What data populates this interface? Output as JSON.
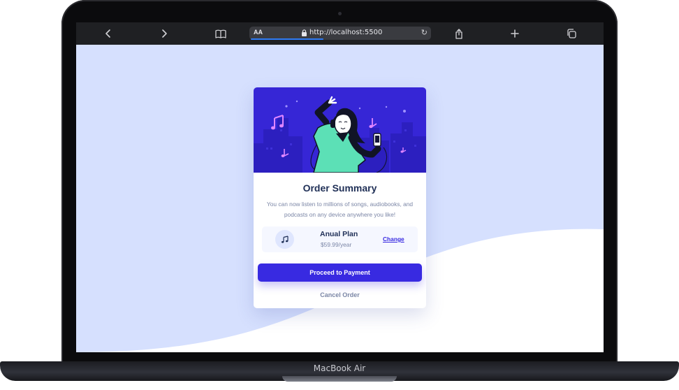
{
  "device": {
    "label": "MacBook Air"
  },
  "browser": {
    "url": "http://localhost:5500",
    "text_size_label": "AA",
    "icons": [
      "back-chevron-icon",
      "forward-chevron-icon",
      "bookmarks-icon",
      "lock-icon",
      "reload-icon",
      "share-icon",
      "new-tab-icon",
      "tabs-icon"
    ]
  },
  "card": {
    "title": "Order Summary",
    "description": "You can now listen to millions of songs, audiobooks, and podcasts on any device anywhere you like!",
    "plan": {
      "icon": "music-note-icon",
      "name": "Anual Plan",
      "price": "$59.99/year",
      "change_label": "Change"
    },
    "primary_button": "Proceed to Payment",
    "secondary_button": "Cancel Order"
  },
  "colors": {
    "page_background": "#d6e0fe",
    "accent": "#382ae1",
    "title_text": "#1f2f56",
    "muted_text": "#7b86a6",
    "plan_background": "#f5f7ff"
  }
}
